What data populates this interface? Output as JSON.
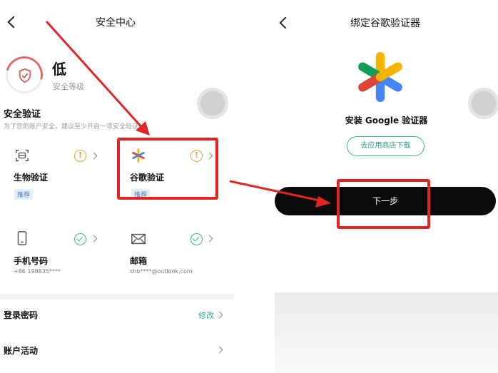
{
  "left_screen": {
    "title": "安全中心",
    "security_level": {
      "value": "低",
      "label": "安全等级",
      "ring_color": "#e06a6a"
    },
    "section": {
      "title": "安全验证",
      "subtitle": "为了您的账户安全，建议至少开启一项安全验证"
    },
    "cards": [
      {
        "name": "生物验证",
        "badge": "推荐",
        "status": "warning",
        "icon": "face-id-icon"
      },
      {
        "name": "谷歌验证",
        "badge": "推荐",
        "status": "warning",
        "icon": "google-authenticator-icon"
      },
      {
        "name": "手机号码",
        "detail": "+86 198835****",
        "status": "verified",
        "icon": "phone-icon"
      },
      {
        "name": "邮箱",
        "detail": "shb****@outlook.com",
        "status": "verified",
        "icon": "mail-icon"
      }
    ],
    "rows": [
      {
        "label": "登录密码",
        "action": "修改"
      },
      {
        "label": "账户活动",
        "action": ""
      }
    ]
  },
  "right_screen": {
    "title": "绑定谷歌验证器",
    "install_text": "安装 Google 验证器",
    "store_button": "去应用商店下载",
    "next_button": "下一步"
  },
  "colors": {
    "highlight_red": "#e02525",
    "accent_green": "#3bb58f",
    "warning_gold": "#d9a43b",
    "button_black": "#0a0a0a"
  }
}
